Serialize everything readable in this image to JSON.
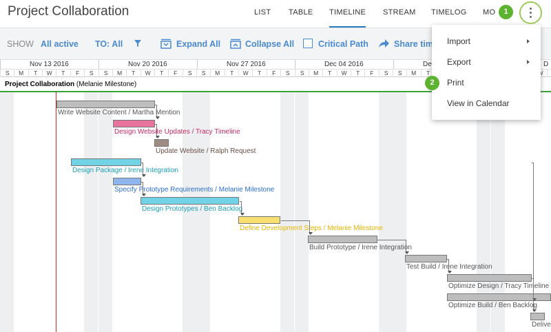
{
  "header": {
    "title": "Project Collaboration",
    "tabs": [
      "LIST",
      "TABLE",
      "TIMELINE",
      "STREAM",
      "TIMELOG",
      "MO"
    ],
    "active_tab": "TIMELINE"
  },
  "toolbar": {
    "show_label": "SHOW",
    "show_value": "All active",
    "to_label": "TO: All",
    "filter_icon": "filter-icon",
    "expand_all": "Expand All",
    "collapse_all": "Collapse All",
    "critical_path": "Critical Path",
    "share": "Share tim"
  },
  "scale": {
    "weeks": [
      "Nov 13 2016",
      "Nov 20 2016",
      "Nov 27 2016",
      "Dec 04 2016",
      "Dec",
      "D"
    ],
    "day_letters": [
      "S",
      "M",
      "T",
      "W",
      "T",
      "F",
      "S",
      "S",
      "M",
      "T",
      "W",
      "T",
      "F",
      "S",
      "S",
      "M",
      "T",
      "W",
      "T",
      "F",
      "S",
      "S",
      "M",
      "T",
      "W",
      "T",
      "F",
      "S",
      "S",
      "M",
      "T",
      "W",
      "T",
      "F",
      "S",
      "S",
      "M",
      "T",
      "W",
      "T"
    ]
  },
  "project": {
    "name": "Project Collaboration",
    "owner": "(Melanie Milestone)"
  },
  "tasks": [
    {
      "label": "Write Website Content / Martha Mention",
      "color": "#bdbdbd",
      "text_color": "#555555"
    },
    {
      "label": "Design Website Updates / Tracy Timeline",
      "color": "#e8739c",
      "text_color": "#c92a5e"
    },
    {
      "label": "Update Website / Ralph Request",
      "color": "#9e8c84",
      "text_color": "#6b4f45"
    },
    {
      "label": "Design Package / Irene Integration",
      "color": "#72d3e6",
      "text_color": "#1a9fb8"
    },
    {
      "label": "Specify Prototype Requirements / Melanie Milestone",
      "color": "#8fb5ee",
      "text_color": "#2a6fd0"
    },
    {
      "label": "Design Prototypes / Ben Backlog",
      "color": "#72d3e6",
      "text_color": "#1a9fb8"
    },
    {
      "label": "Define Development Steps / Melanie Milestone",
      "color": "#f8e070",
      "text_color": "#e8b400"
    },
    {
      "label": "Build Prototype / Irene Integration",
      "color": "#bdbdbd",
      "text_color": "#555555"
    },
    {
      "label": "Test Build / Irene Integration",
      "color": "#bdbdbd",
      "text_color": "#555555"
    },
    {
      "label": "Optimize Design / Tracy Timeline",
      "color": "#bdbdbd",
      "text_color": "#555555"
    },
    {
      "label": "Optimize Build / Ben Backlog",
      "color": "#bdbdbd",
      "text_color": "#555555"
    },
    {
      "label": "Delive",
      "color": "#bdbdbd",
      "text_color": "#555555"
    }
  ],
  "menu": {
    "items": [
      "Import",
      "Export",
      "Print",
      "View in Calendar"
    ],
    "has_submenu": [
      true,
      true,
      false,
      false
    ]
  },
  "badges": [
    "1",
    "2"
  ],
  "colors": {
    "accent": "#2a7ab8",
    "toolbar_text": "#4a8ad0",
    "today_line": "#d9261c",
    "project_line": "#3aa43a",
    "badge": "#5cb32f"
  }
}
